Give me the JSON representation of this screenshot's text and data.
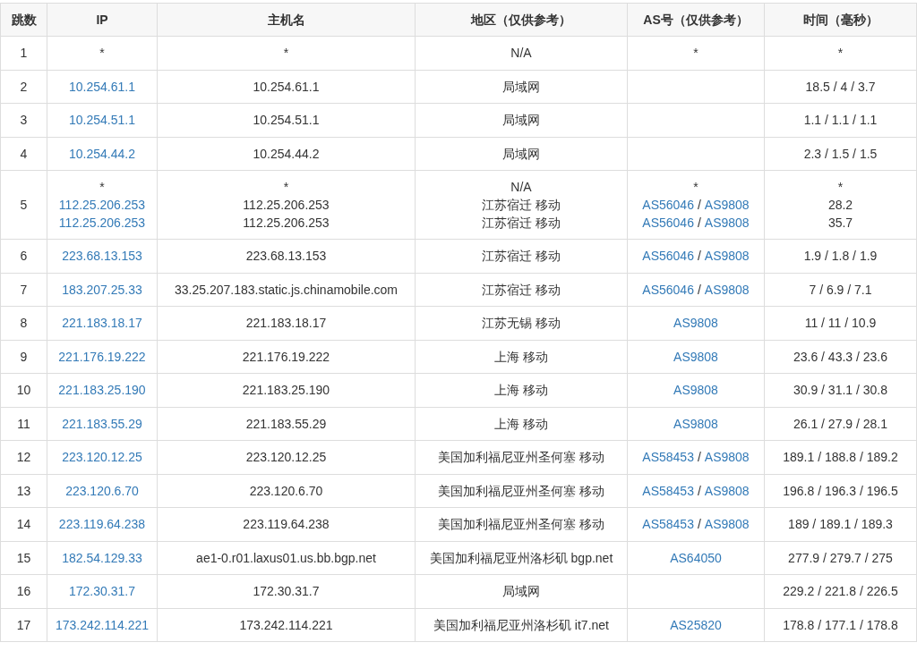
{
  "columns": [
    "跳数",
    "IP",
    "主机名",
    "地区（仅供参考）",
    "AS号（仅供参考）",
    "时间（毫秒）"
  ],
  "hops": [
    {
      "hop": "1",
      "lines": [
        {
          "ip": {
            "kind": "text",
            "text": "*"
          },
          "host": "*",
          "region": "N/A",
          "as": [
            {
              "kind": "text",
              "text": "*"
            }
          ],
          "time": "*"
        }
      ]
    },
    {
      "hop": "2",
      "lines": [
        {
          "ip": {
            "kind": "link",
            "text": "10.254.61.1"
          },
          "host": "10.254.61.1",
          "region": "局域网",
          "time": "18.5 / 4 / 3.7"
        }
      ]
    },
    {
      "hop": "3",
      "lines": [
        {
          "ip": {
            "kind": "link",
            "text": "10.254.51.1"
          },
          "host": "10.254.51.1",
          "region": "局域网",
          "time": "1.1 / 1.1 / 1.1"
        }
      ]
    },
    {
      "hop": "4",
      "lines": [
        {
          "ip": {
            "kind": "link",
            "text": "10.254.44.2"
          },
          "host": "10.254.44.2",
          "region": "局域网",
          "time": "2.3 / 1.5 / 1.5"
        }
      ]
    },
    {
      "hop": "5",
      "lines": [
        {
          "ip": {
            "kind": "text",
            "text": "*"
          },
          "host": "*",
          "region": "N/A",
          "as": [
            {
              "kind": "text",
              "text": "*"
            }
          ],
          "time": "*"
        },
        {
          "ip": {
            "kind": "link",
            "text": "112.25.206.253"
          },
          "host": "112.25.206.253",
          "region": "江苏宿迁 移动",
          "as": [
            {
              "kind": "link",
              "text": "AS56046"
            },
            {
              "kind": "text",
              "text": "/"
            },
            {
              "kind": "link",
              "text": "AS9808"
            }
          ],
          "time": "28.2"
        },
        {
          "ip": {
            "kind": "link",
            "text": "112.25.206.253"
          },
          "host": "112.25.206.253",
          "region": "江苏宿迁 移动",
          "as": [
            {
              "kind": "link",
              "text": "AS56046"
            },
            {
              "kind": "text",
              "text": "/"
            },
            {
              "kind": "link",
              "text": "AS9808"
            }
          ],
          "time": "35.7"
        }
      ]
    },
    {
      "hop": "6",
      "lines": [
        {
          "ip": {
            "kind": "link",
            "text": "223.68.13.153"
          },
          "host": "223.68.13.153",
          "region": "江苏宿迁 移动",
          "as": [
            {
              "kind": "link",
              "text": "AS56046"
            },
            {
              "kind": "text",
              "text": "/"
            },
            {
              "kind": "link",
              "text": "AS9808"
            }
          ],
          "time": "1.9 / 1.8 / 1.9"
        }
      ]
    },
    {
      "hop": "7",
      "lines": [
        {
          "ip": {
            "kind": "link",
            "text": "183.207.25.33"
          },
          "host": "33.25.207.183.static.js.chinamobile.com",
          "region": "江苏宿迁 移动",
          "as": [
            {
              "kind": "link",
              "text": "AS56046"
            },
            {
              "kind": "text",
              "text": "/"
            },
            {
              "kind": "link",
              "text": "AS9808"
            }
          ],
          "time": "7 / 6.9 / 7.1"
        }
      ]
    },
    {
      "hop": "8",
      "lines": [
        {
          "ip": {
            "kind": "link",
            "text": "221.183.18.17"
          },
          "host": "221.183.18.17",
          "region": "江苏无锡 移动",
          "as": [
            {
              "kind": "link",
              "text": "AS9808"
            }
          ],
          "time": "11 / 11 / 10.9"
        }
      ]
    },
    {
      "hop": "9",
      "lines": [
        {
          "ip": {
            "kind": "link",
            "text": "221.176.19.222"
          },
          "host": "221.176.19.222",
          "region": "上海 移动",
          "as": [
            {
              "kind": "link",
              "text": "AS9808"
            }
          ],
          "time": "23.6 / 43.3 / 23.6"
        }
      ]
    },
    {
      "hop": "10",
      "lines": [
        {
          "ip": {
            "kind": "link",
            "text": "221.183.25.190"
          },
          "host": "221.183.25.190",
          "region": "上海 移动",
          "as": [
            {
              "kind": "link",
              "text": "AS9808"
            }
          ],
          "time": "30.9 / 31.1 / 30.8"
        }
      ]
    },
    {
      "hop": "11",
      "lines": [
        {
          "ip": {
            "kind": "link",
            "text": "221.183.55.29"
          },
          "host": "221.183.55.29",
          "region": "上海 移动",
          "as": [
            {
              "kind": "link",
              "text": "AS9808"
            }
          ],
          "time": "26.1 / 27.9 / 28.1"
        }
      ]
    },
    {
      "hop": "12",
      "lines": [
        {
          "ip": {
            "kind": "link",
            "text": "223.120.12.25"
          },
          "host": "223.120.12.25",
          "region": "美国加利福尼亚州圣何塞 移动",
          "as": [
            {
              "kind": "link",
              "text": "AS58453"
            },
            {
              "kind": "text",
              "text": "/"
            },
            {
              "kind": "link",
              "text": "AS9808"
            }
          ],
          "time": "189.1 / 188.8 / 189.2"
        }
      ]
    },
    {
      "hop": "13",
      "lines": [
        {
          "ip": {
            "kind": "link",
            "text": "223.120.6.70"
          },
          "host": "223.120.6.70",
          "region": "美国加利福尼亚州圣何塞 移动",
          "as": [
            {
              "kind": "link",
              "text": "AS58453"
            },
            {
              "kind": "text",
              "text": "/"
            },
            {
              "kind": "link",
              "text": "AS9808"
            }
          ],
          "time": "196.8 / 196.3 / 196.5"
        }
      ]
    },
    {
      "hop": "14",
      "lines": [
        {
          "ip": {
            "kind": "link",
            "text": "223.119.64.238"
          },
          "host": "223.119.64.238",
          "region": "美国加利福尼亚州圣何塞 移动",
          "as": [
            {
              "kind": "link",
              "text": "AS58453"
            },
            {
              "kind": "text",
              "text": "/"
            },
            {
              "kind": "link",
              "text": "AS9808"
            }
          ],
          "time": "189 / 189.1 / 189.3"
        }
      ]
    },
    {
      "hop": "15",
      "lines": [
        {
          "ip": {
            "kind": "link",
            "text": "182.54.129.33"
          },
          "host": "ae1-0.r01.laxus01.us.bb.bgp.net",
          "region": "美国加利福尼亚州洛杉矶 bgp.net",
          "as": [
            {
              "kind": "link",
              "text": "AS64050"
            }
          ],
          "time": "277.9 / 279.7 / 275"
        }
      ]
    },
    {
      "hop": "16",
      "lines": [
        {
          "ip": {
            "kind": "link",
            "text": "172.30.31.7"
          },
          "host": "172.30.31.7",
          "region": "局域网",
          "time": "229.2 / 221.8 / 226.5"
        }
      ]
    },
    {
      "hop": "17",
      "lines": [
        {
          "ip": {
            "kind": "link",
            "text": "173.242.114.221"
          },
          "host": "173.242.114.221",
          "region": "美国加利福尼亚州洛杉矶 it7.net",
          "as": [
            {
              "kind": "link",
              "text": "AS25820"
            }
          ],
          "time": "178.8 / 177.1 / 178.8"
        }
      ]
    }
  ]
}
